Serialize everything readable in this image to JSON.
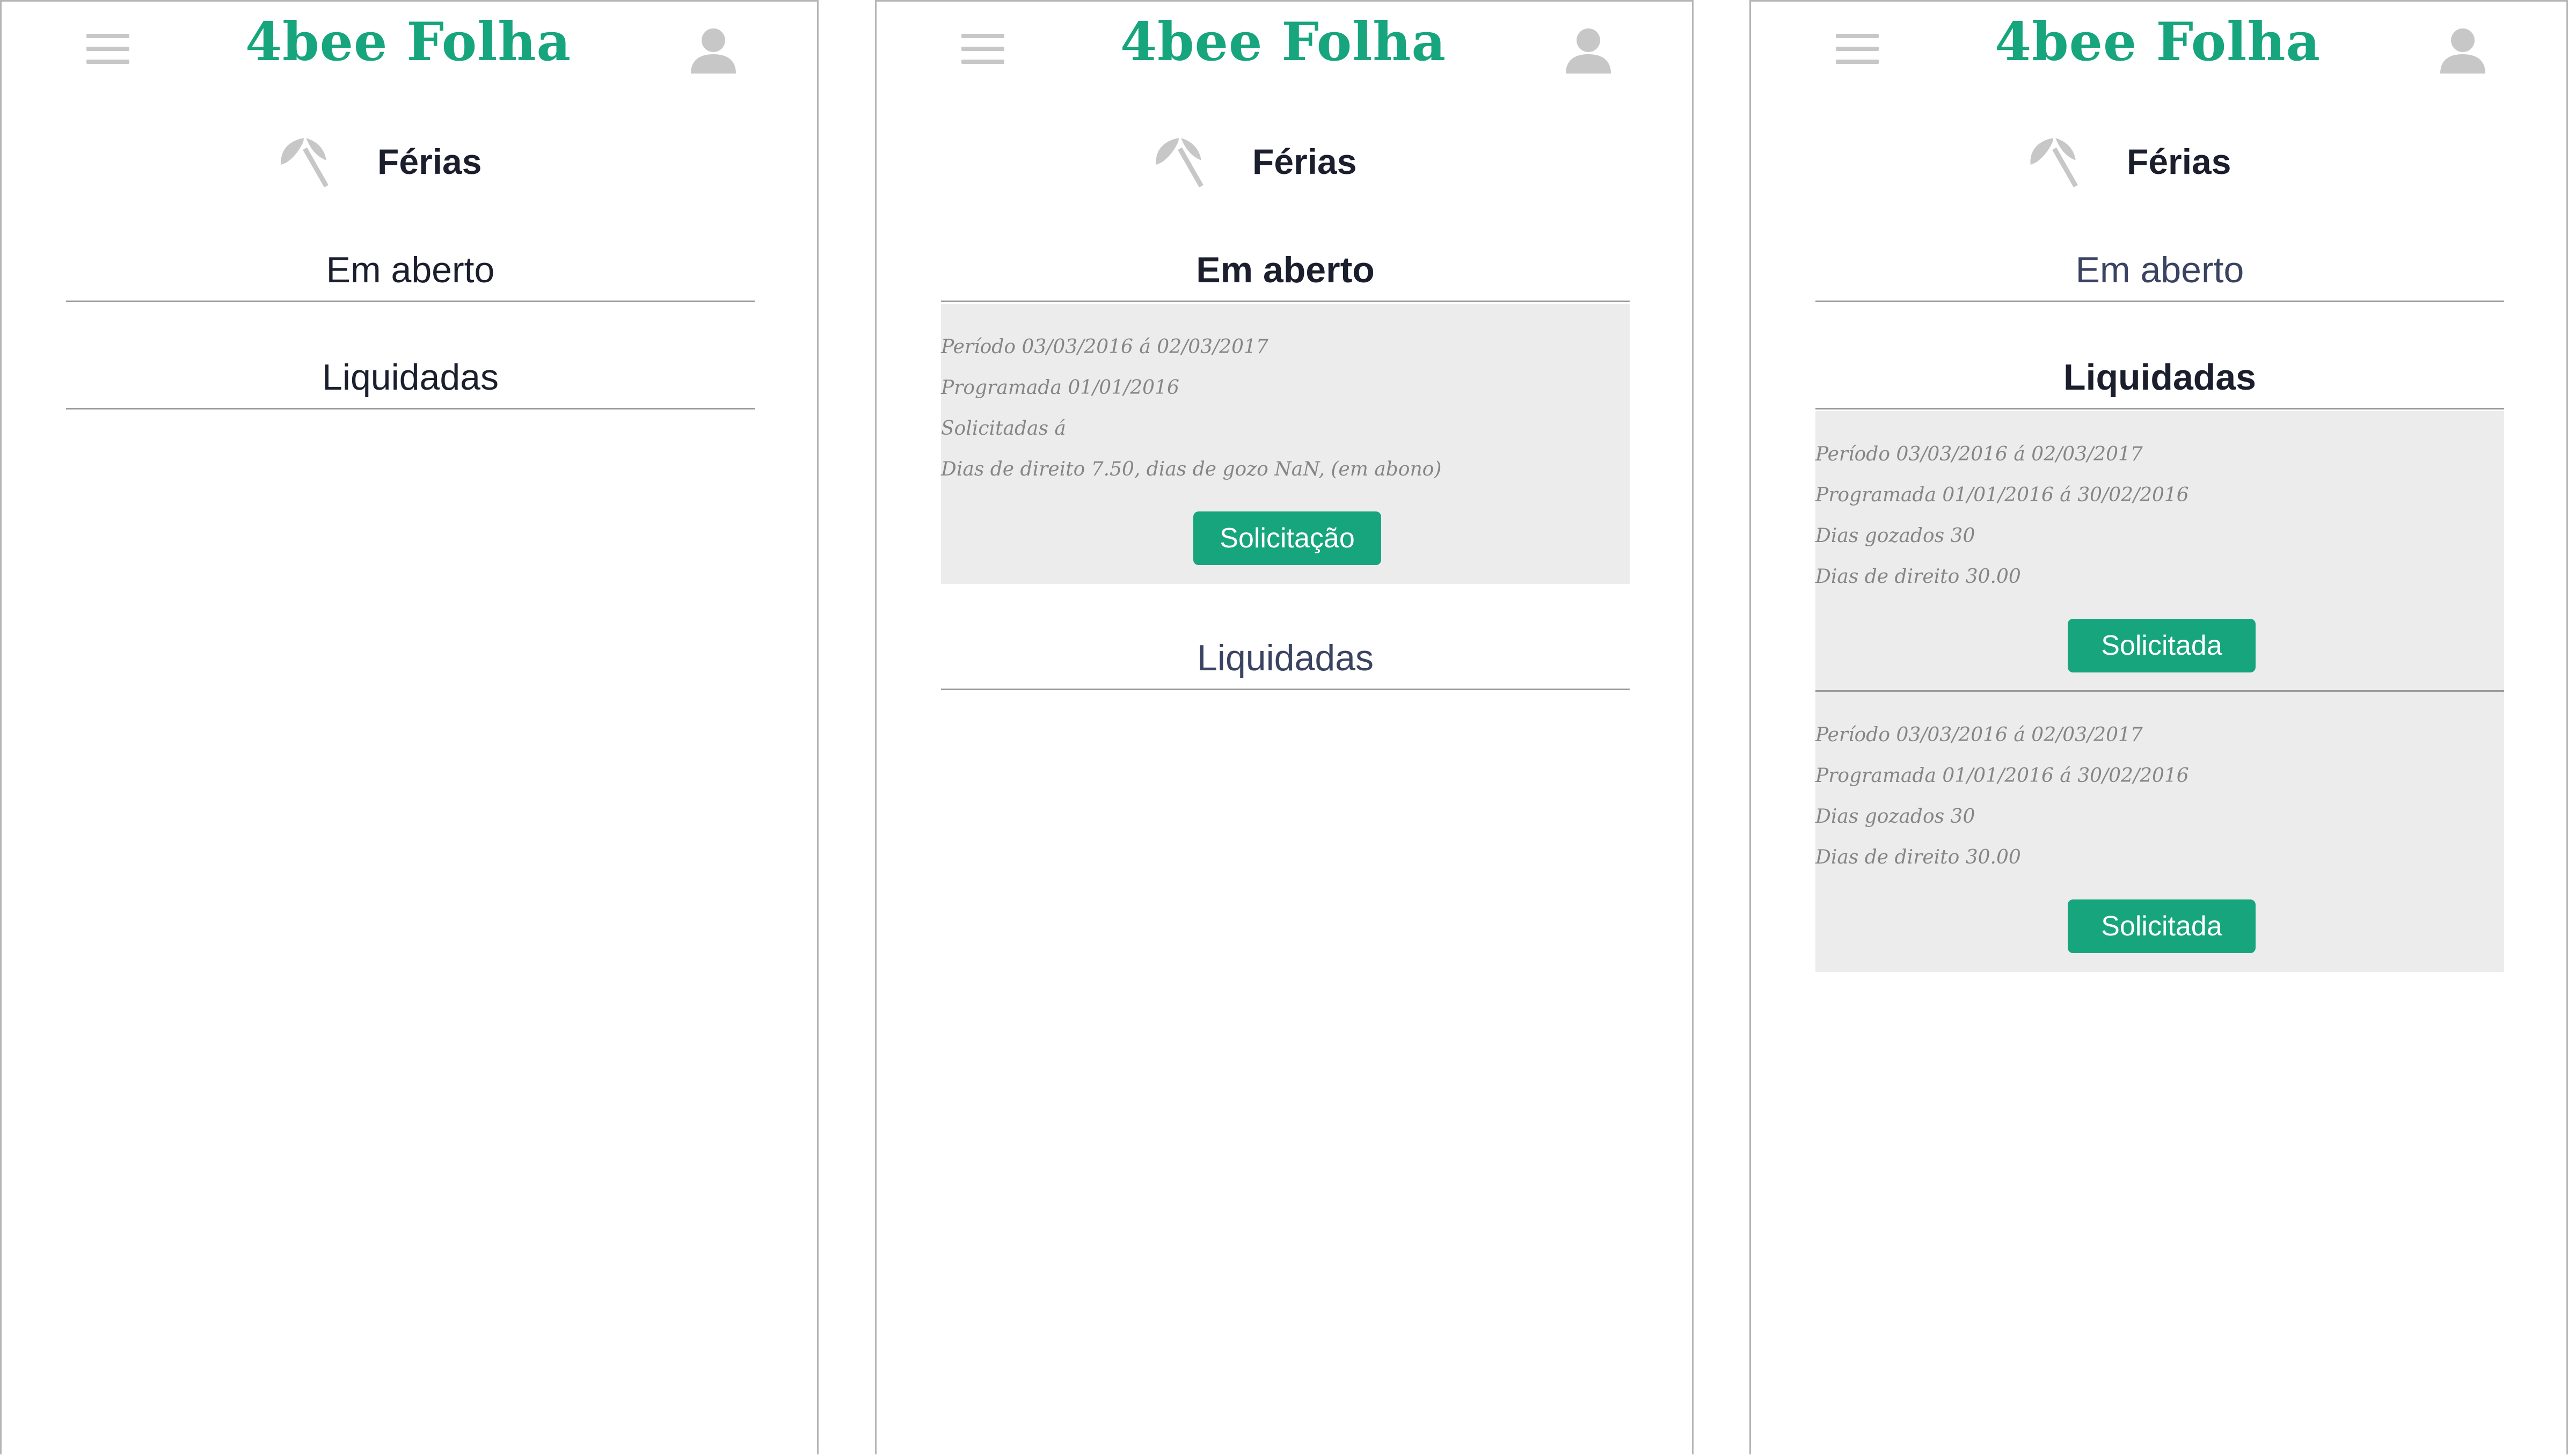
{
  "app": {
    "brand": "4bee Folha"
  },
  "header": {
    "menu_icon": "hamburger-icon",
    "profile_icon": "user-avatar-icon"
  },
  "section": {
    "title": "Férias",
    "icon": "beach-umbrella-icon"
  },
  "tabs": {
    "open": "Em aberto",
    "settled": "Liquidadas"
  },
  "colors": {
    "accent": "#17a57d",
    "text": "#1b1e2d",
    "muted": "#858585",
    "card_bg": "#ececec"
  },
  "screens": [
    {
      "name": "overview",
      "active_tab": ""
    },
    {
      "name": "open-expanded",
      "active_tab": "Em aberto",
      "open_items": [
        {
          "lines": [
            "Período 03/03/2016 á 02/03/2017",
            "Programada 01/01/2016",
            "Solicitadas á",
            "Dias de direito 7.50, dias de gozo NaN, (em abono)"
          ],
          "button": "Solicitação"
        }
      ]
    },
    {
      "name": "settled-expanded",
      "active_tab": "Liquidadas",
      "settled_items": [
        {
          "lines": [
            "Período 03/03/2016 á 02/03/2017",
            "Programada 01/01/2016 á 30/02/2016",
            "Dias gozados 30",
            "Dias de direito 30.00"
          ],
          "button": "Solicitada"
        },
        {
          "lines": [
            "Período 03/03/2016 á 02/03/2017",
            "Programada 01/01/2016 á 30/02/2016",
            "Dias gozados 30",
            "Dias de direito 30.00"
          ],
          "button": "Solicitada"
        }
      ]
    }
  ]
}
